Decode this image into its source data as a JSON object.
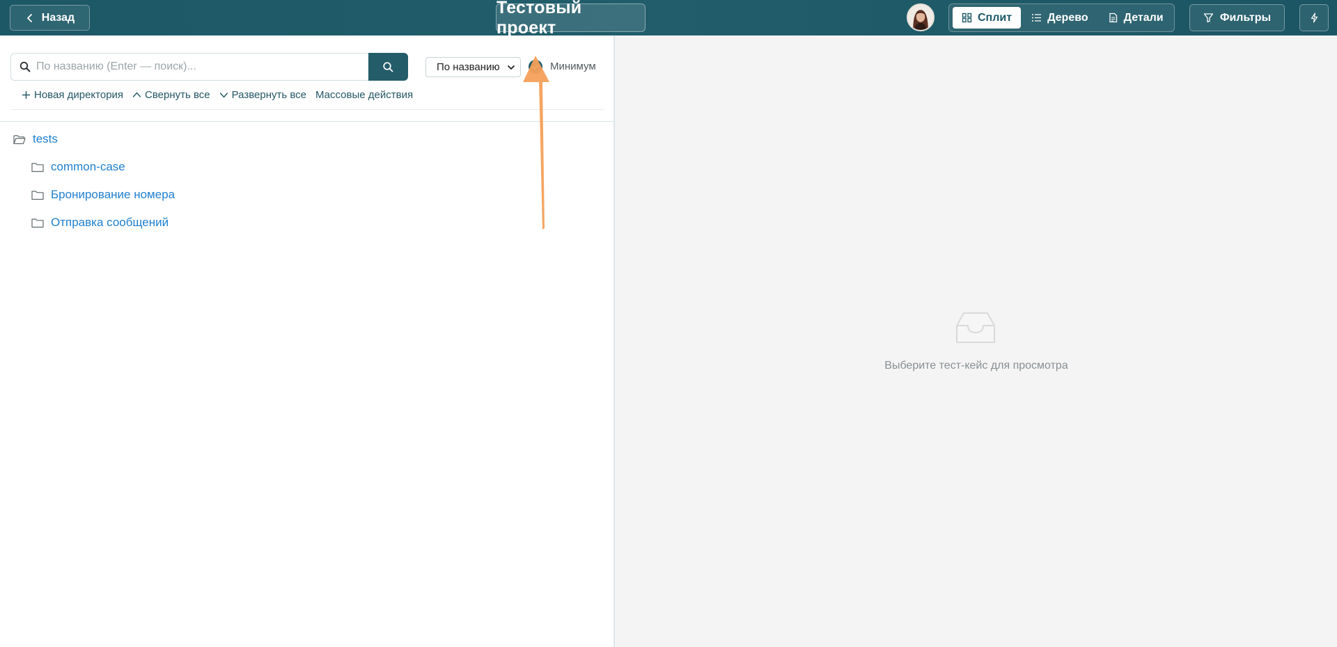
{
  "header": {
    "back_label": "Назад",
    "project_title": "Тестовый проект",
    "views": [
      {
        "label": "Сплит",
        "icon": "split-icon",
        "active": true
      },
      {
        "label": "Дерево",
        "icon": "list-icon",
        "active": false
      },
      {
        "label": "Детали",
        "icon": "file-icon",
        "active": false
      }
    ],
    "filters_label": "Фильтры",
    "flash_icon": "lightning-icon"
  },
  "toolbar": {
    "search_placeholder": "По названию (Enter — поиск)...",
    "search_value": "",
    "sort_selected": "По названию",
    "minimum_label": "Минимум",
    "minimum_checked": true,
    "actions": {
      "new_dir": "Новая директория",
      "collapse_all": "Свернуть все",
      "expand_all": "Развернуть все",
      "bulk": "Массовые действия"
    }
  },
  "tree": {
    "root": "tests",
    "children": [
      "common-case",
      "Бронирование номера",
      "Отправка сообщений"
    ]
  },
  "detail": {
    "empty_text": "Выберите тест-кейс для просмотра"
  },
  "colors": {
    "header": "#1d5866",
    "accent": "#245c69",
    "link": "#1f7fd0",
    "annotation_arrow": "#f5a05a"
  }
}
